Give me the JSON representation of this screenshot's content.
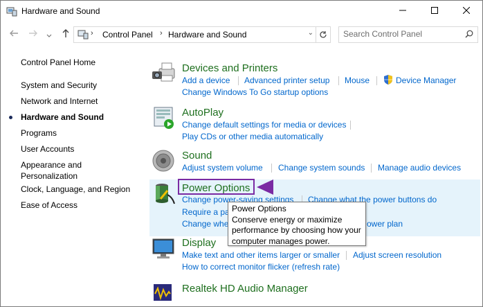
{
  "window": {
    "title": "Hardware and Sound"
  },
  "nav": {
    "breadcrumbs": [
      "Control Panel",
      "Hardware and Sound"
    ],
    "search_placeholder": "Search Control Panel"
  },
  "leftnav": {
    "home": "Control Panel Home",
    "items": [
      {
        "label": "System and Security",
        "active": false
      },
      {
        "label": "Network and Internet",
        "active": false
      },
      {
        "label": "Hardware and Sound",
        "active": true
      },
      {
        "label": "Programs",
        "active": false
      },
      {
        "label": "User Accounts",
        "active": false
      },
      {
        "label": "Appearance and Personalization",
        "active": false
      },
      {
        "label": "Clock, Language, and Region",
        "active": false
      },
      {
        "label": "Ease of Access",
        "active": false
      }
    ]
  },
  "categories": {
    "devices": {
      "title": "Devices and Printers",
      "links": [
        "Add a device",
        "Advanced printer setup",
        "Mouse",
        "Device Manager",
        "Change Windows To Go startup options"
      ]
    },
    "autoplay": {
      "title": "AutoPlay",
      "links": [
        "Change default settings for media or devices",
        "Play CDs or other media automatically"
      ]
    },
    "sound": {
      "title": "Sound",
      "links": [
        "Adjust system volume",
        "Change system sounds",
        "Manage audio devices"
      ]
    },
    "power": {
      "title": "Power Options",
      "links": [
        "Change power-saving settings",
        "Change what the power buttons do",
        "Require a pa",
        "Change whe",
        "ower plan"
      ]
    },
    "display": {
      "title": "Display",
      "links": [
        "Make text and other items larger or smaller",
        "Adjust screen resolution",
        "How to correct monitor flicker (refresh rate)"
      ]
    },
    "realtek": {
      "title": "Realtek HD Audio Manager"
    }
  },
  "tooltip": {
    "title": "Power Options",
    "lines": [
      "Conserve energy or maximize",
      "performance by choosing how your",
      "computer manages power."
    ]
  },
  "colors": {
    "category_title": "#1e6f1e",
    "link": "#0066cc",
    "highlight": "#e5f3fb",
    "annotation": "#7a2aa3"
  }
}
